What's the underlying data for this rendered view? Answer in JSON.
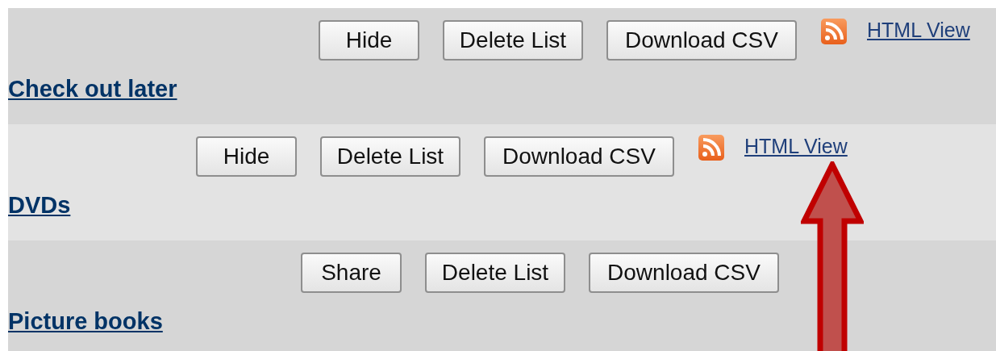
{
  "lists": [
    {
      "title": "Check out later",
      "buttons": [
        "Hide",
        "Delete List",
        "Download CSV"
      ],
      "rss": true,
      "html_view": "HTML View"
    },
    {
      "title": "DVDs",
      "buttons": [
        "Hide",
        "Delete List",
        "Download CSV"
      ],
      "rss": true,
      "html_view": "HTML View"
    },
    {
      "title": "Picture books",
      "buttons": [
        "Share",
        "Delete List",
        "Download CSV"
      ],
      "rss": false
    }
  ]
}
